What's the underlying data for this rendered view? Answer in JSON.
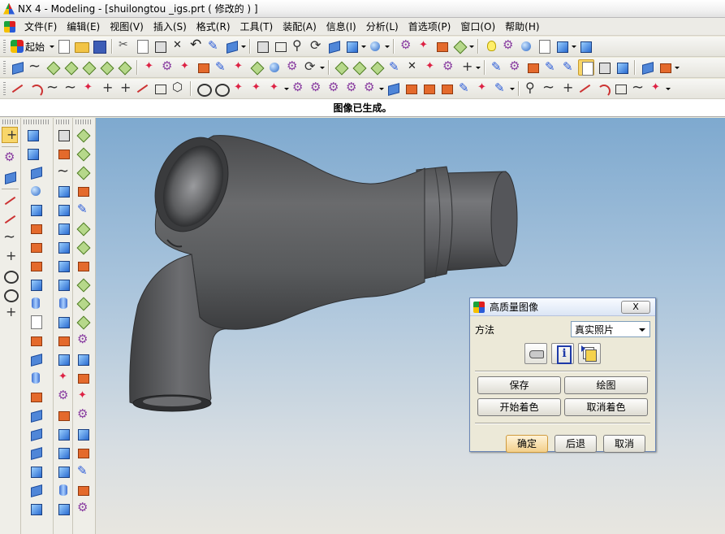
{
  "window": {
    "title": "NX 4 - Modeling - [shuilongtou _igs.prt ( 修改的 ) ]"
  },
  "menu": {
    "items": [
      "文件(F)",
      "编辑(E)",
      "视图(V)",
      "插入(S)",
      "格式(R)",
      "工具(T)",
      "装配(A)",
      "信息(I)",
      "分析(L)",
      "首选项(P)",
      "窗口(O)",
      "帮助(H)"
    ]
  },
  "toolbar": {
    "start_label": "起始",
    "start_icon": "start-nx-icon"
  },
  "status": {
    "message": "图像已生成。"
  },
  "dialog": {
    "title": "高质量图像",
    "close_label": "X",
    "method_label": "方法",
    "method_value": "真实照片",
    "icons": [
      "hand-icon",
      "info-icon",
      "copy-settings-icon"
    ],
    "buttons": {
      "save": "保存",
      "plot": "绘图",
      "start_shading": "开始着色",
      "cancel_shading": "取消着色"
    },
    "bottom": {
      "ok": "确定",
      "back": "后退",
      "cancel": "取消"
    }
  },
  "viewport": {
    "model": "faucet-spout-part",
    "background_top": "#7ea9cf",
    "background_bottom": "#e8e6e0",
    "model_color": "#5b5c5e"
  }
}
